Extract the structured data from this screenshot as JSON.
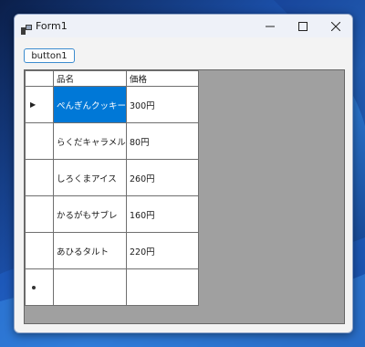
{
  "window": {
    "title": "Form1",
    "icon": "winforms-app-icon"
  },
  "controls": {
    "minimize_icon": "minimize-icon",
    "maximize_icon": "maximize-icon",
    "close_icon": "close-icon"
  },
  "button1": {
    "label": "button1"
  },
  "grid": {
    "columns": [
      "品名",
      "価格"
    ],
    "rows": [
      {
        "name": "ぺんぎんクッキー",
        "price": "300円"
      },
      {
        "name": "らくだキャラメル",
        "price": "80円"
      },
      {
        "name": "しろくまアイス",
        "price": "260円"
      },
      {
        "name": "かるがもサブレ",
        "price": "160円"
      },
      {
        "name": "あひるタルト",
        "price": "220円"
      }
    ],
    "selected_cell": "ぺんぎんクッキー",
    "current_row_marker": "▶",
    "colors": {
      "selection": "#0078d7",
      "grid_background": "#a0a0a0"
    }
  }
}
